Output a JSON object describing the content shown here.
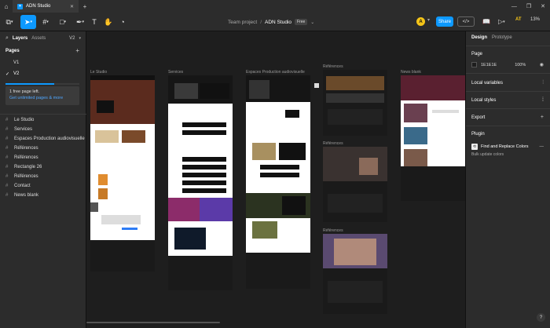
{
  "titlebar": {
    "home_icon": "home-icon",
    "tab_title": "ADN Studio",
    "close_icon": "close-icon",
    "new_tab_icon": "plus-icon",
    "window_controls": [
      "minimize-icon",
      "maximize-icon",
      "close-icon"
    ]
  },
  "toolbar": {
    "tools": [
      "main-menu-icon",
      "move-tool-icon",
      "frame-tool-icon",
      "shape-tool-icon",
      "pen-tool-icon",
      "text-tool-icon",
      "hand-tool-icon",
      "comment-tool-icon"
    ],
    "project": "Team project",
    "separator": "/",
    "file_name": "ADN Studio",
    "plan_badge": "Free",
    "avatar_initial": "A",
    "share_label": "Share",
    "zoom": "13%",
    "collab_initials": "AT"
  },
  "left_panel": {
    "tab_layers": "Layers",
    "tab_assets": "Assets",
    "version": "V2",
    "pages_title": "Pages",
    "pages": [
      {
        "name": "V1",
        "active": false
      },
      {
        "name": "V2",
        "active": true
      }
    ],
    "progress": 0.66,
    "notice_line1": "1 free page left.",
    "notice_link": "Get unlimited pages & more",
    "layers": [
      "Le Studio",
      "Services",
      "Espaces Production audiovisuelle",
      "Références",
      "Références",
      "Rectangle 26",
      "Références",
      "Contact",
      "News blank"
    ]
  },
  "canvas": {
    "frame_labels": [
      "Le Studio",
      "Services",
      "Espaces Production audiovisuelle",
      "Références",
      "Références",
      "Références",
      "News blank"
    ]
  },
  "right_panel": {
    "tab_design": "Design",
    "tab_prototype": "Prototype",
    "page_title": "Page",
    "page_color": "1E1E1E",
    "page_opacity": "100%",
    "local_variables": "Local variables",
    "local_styles": "Local styles",
    "export": "Export",
    "plugin_title": "Plugin",
    "plugin_name": "Find and Replace Colors",
    "plugin_desc": "Bulk update colors"
  },
  "colors": {
    "accent": "#0d99ff",
    "canvas_bg": "#1e1e1e",
    "panel_bg": "#2c2c2c",
    "avatar": "#f5c518"
  }
}
